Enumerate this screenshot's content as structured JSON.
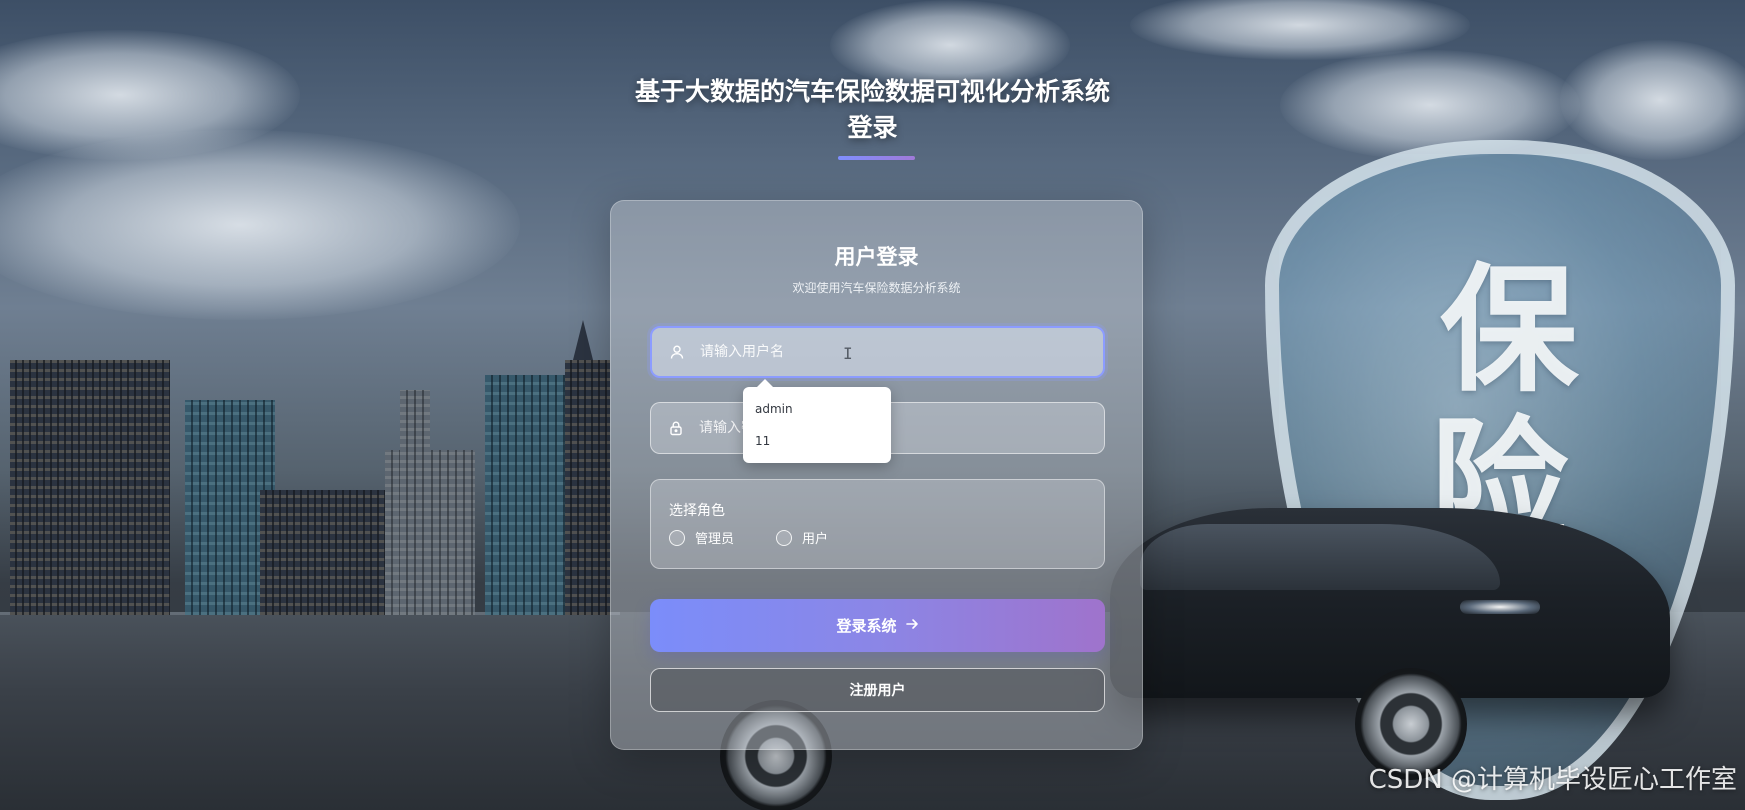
{
  "header": {
    "title_line1": "基于大数据的汽车保险数据可视化分析系统",
    "title_line2": "登录"
  },
  "login_card": {
    "title": "用户登录",
    "subtitle": "欢迎使用汽车保险数据分析系统",
    "username": {
      "placeholder": "请输入用户名",
      "value": "",
      "icon": "user-icon"
    },
    "password": {
      "placeholder": "请输入密码",
      "value": "",
      "icon": "lock-icon"
    },
    "role": {
      "label": "选择角色",
      "options": [
        "管理员",
        "用户"
      ],
      "selected": null
    },
    "login_button": {
      "label": "登录系统",
      "icon": "arrow-right-icon"
    },
    "register_button": {
      "label": "注册用户"
    }
  },
  "autocomplete": {
    "items": [
      "admin",
      "11"
    ]
  },
  "background": {
    "shield_text": [
      "保",
      "险"
    ]
  },
  "watermark": "CSDN @计算机毕设匠心工作室",
  "colors": {
    "accent_start": "#7b8dfa",
    "accent_end": "#9f73cc",
    "focus_border": "#8c9cff"
  }
}
